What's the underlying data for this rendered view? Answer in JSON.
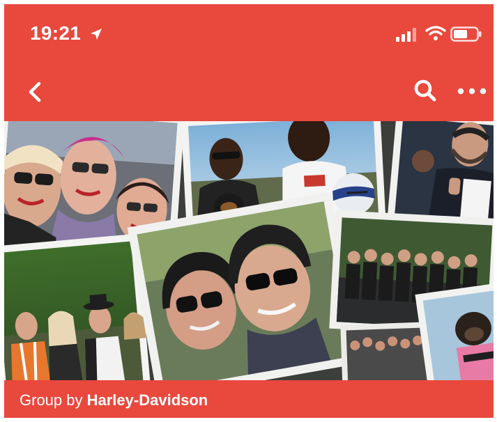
{
  "status_bar": {
    "time": "19:21",
    "icons": [
      "location-arrow-icon",
      "cellular-signal-icon",
      "wifi-icon",
      "battery-icon"
    ]
  },
  "nav": {
    "icons": [
      "back-chevron-icon",
      "search-icon",
      "more-icon"
    ]
  },
  "cover": {
    "description_icons": [
      "photo-collage"
    ]
  },
  "footer": {
    "prefix": "Group by",
    "group_name": "Harley-Davidson"
  },
  "colors": {
    "header": "#e9483c",
    "text": "#ffffff"
  }
}
